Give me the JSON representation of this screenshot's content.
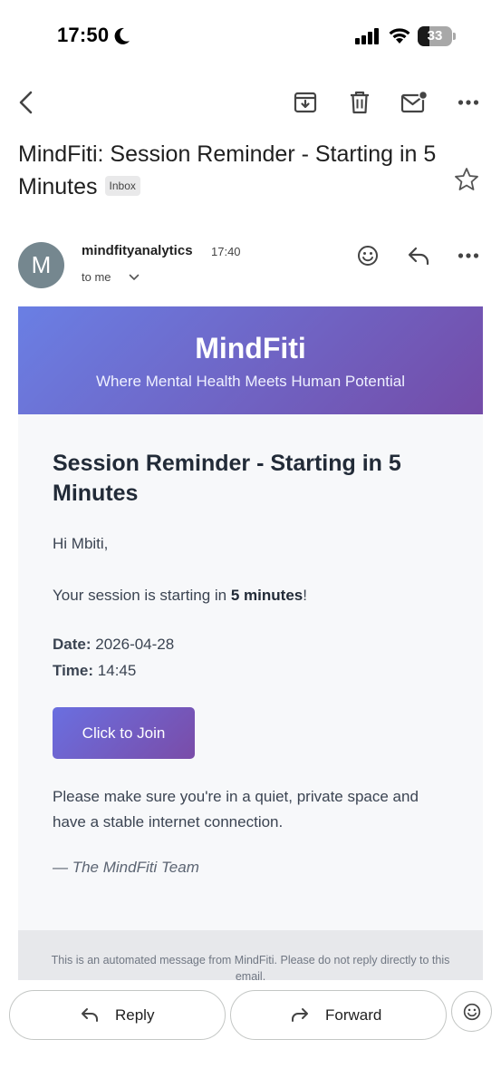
{
  "status": {
    "time": "17:50",
    "battery": "33",
    "battery_level": 0.33
  },
  "subject": {
    "title": "MindFiti: Session Reminder - Starting in 5 Minutes",
    "label": "Inbox"
  },
  "sender": {
    "avatar_letter": "M",
    "name": "mindfityanalytics",
    "time": "17:40",
    "recipient": "to me"
  },
  "email": {
    "brand": "MindFiti",
    "tagline": "Where Mental Health Meets Human Potential",
    "heading": "Session Reminder - Starting in 5 Minutes",
    "greeting": "Hi Mbiti,",
    "line_prefix": "Your session is starting in ",
    "line_emphasis": "5 minutes",
    "line_suffix": "!",
    "date_label": "Date:",
    "date_value": "2026-04-28",
    "time_label": "Time:",
    "time_value": "14:45",
    "join_button": "Click to Join",
    "note": "Please make sure you're in a quiet, private space and have a stable internet connection.",
    "signoff": "— The MindFiti Team",
    "footer": "This is an automated message from MindFiti. Please do not reply directly to this email."
  },
  "actions": {
    "reply": "Reply",
    "forward": "Forward"
  },
  "icons": {
    "back": "back-arrow-icon",
    "archive": "archive-icon",
    "delete": "trash-icon",
    "unread": "mark-unread-icon",
    "more": "more-vert-icon",
    "star": "star-icon",
    "emoji": "emoji-icon",
    "reply": "reply-icon",
    "forward": "forward-icon"
  },
  "colors": {
    "banner_start": "#6a7fe4",
    "banner_end": "#744ca8",
    "avatar": "#75878f"
  }
}
